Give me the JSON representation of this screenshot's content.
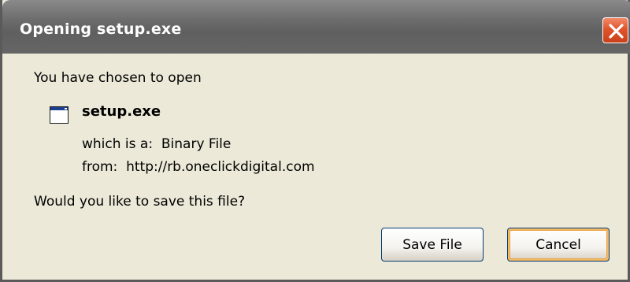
{
  "dialog": {
    "title": "Opening setup.exe",
    "close_icon": "close-icon",
    "intro": "You have chosen to open",
    "file": {
      "icon": "application-window-icon",
      "name": "setup.exe",
      "type_label": "which is a:",
      "type_value": "Binary File",
      "from_label": "from:",
      "from_value": "http://rb.oneclickdigital.com"
    },
    "question": "Would you like to save this file?",
    "buttons": {
      "save_label": "Save File",
      "cancel_label": "Cancel"
    }
  },
  "colors": {
    "titlebar": "#6e6e6e",
    "close_button": "#e0542b",
    "body_background": "#ece9d8",
    "default_button_focus": "#f5b962"
  }
}
